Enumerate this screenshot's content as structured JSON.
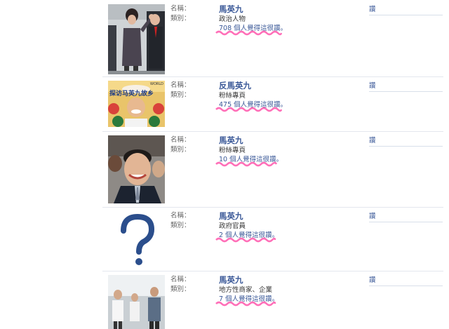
{
  "field_labels": {
    "name": "名稱：",
    "type": "類別："
  },
  "pages": [
    {
      "name": "馬英九",
      "category": "政治人物",
      "likes": "708 個人覺得這很讚。",
      "like_button": "讚"
    },
    {
      "name": "反馬英九",
      "category": "粉絲專頁",
      "likes": "475 個人覺得這很讚。",
      "like_button": "讚",
      "photo_text": "探访马英九故乡",
      "photo_corner": "WORLD"
    },
    {
      "name": "馬英九",
      "category": "粉絲專頁",
      "likes": "10 個人覺得這很讚。",
      "like_button": "讚"
    },
    {
      "name": "馬英九",
      "category": "政府官員",
      "likes": "2 個人覺得這很讚。",
      "like_button": "讚"
    },
    {
      "name": "馬英九",
      "category": "地方性商家、企業",
      "likes": "7 個人覺得這很讚。",
      "like_button": "讚"
    }
  ],
  "colors": {
    "link": "#3b5998",
    "scribble": "#ff3fa0",
    "question_mark": "#2b4e8c"
  }
}
